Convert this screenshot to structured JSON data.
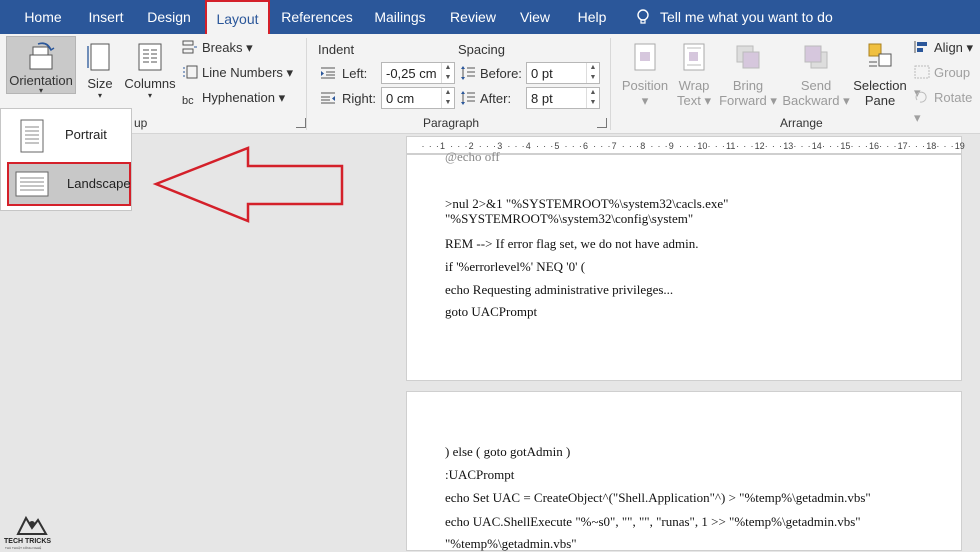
{
  "tabs": [
    "Home",
    "Insert",
    "Design",
    "Layout",
    "References",
    "Mailings",
    "Review",
    "View",
    "Help"
  ],
  "tell_me": "Tell me what you want to do",
  "page_setup": {
    "orientation": "Orientation",
    "size": "Size",
    "columns": "Columns",
    "breaks": "Breaks",
    "line_numbers": "Line Numbers",
    "hyphenation": "Hyphenation",
    "group_fragment": "up"
  },
  "paragraph": {
    "indent": "Indent",
    "spacing": "Spacing",
    "left_label": "Left:",
    "left_value": "-0,25 cm",
    "right_label": "Right:",
    "right_value": "0 cm",
    "before_label": "Before:",
    "before_value": "0 pt",
    "after_label": "After:",
    "after_value": "8 pt",
    "group": "Paragraph"
  },
  "arrange": {
    "position": [
      "Position",
      "▾"
    ],
    "wrap": [
      "Wrap",
      "Text ▾"
    ],
    "bring": [
      "Bring",
      "Forward ▾"
    ],
    "send": [
      "Send",
      "Backward ▾"
    ],
    "selection": [
      "Selection",
      "Pane"
    ],
    "align": "Align",
    "group": "Group",
    "rotate": "Rotate",
    "group_label": "Arrange"
  },
  "orientation_menu": {
    "portrait": "Portrait",
    "landscape": "Landscape"
  },
  "ruler_ticks": [
    "1",
    "2",
    "3",
    "4",
    "5",
    "6",
    "7",
    "8",
    "9",
    "10",
    "11",
    "12",
    "13",
    "14",
    "15",
    "16",
    "17",
    "18",
    "19"
  ],
  "page1_lines": [
    ">nul 2>&1 \"%SYSTEMROOT%\\system32\\cacls.exe\"",
    "\"%SYSTEMROOT%\\system32\\config\\system\"",
    "REM --> If error flag set, we do not have admin.",
    "if '%errorlevel%' NEQ '0' (",
    "echo Requesting administrative privileges...",
    "goto UACPrompt"
  ],
  "page2_lines": [
    ") else ( goto gotAdmin )",
    ":UACPrompt",
    "echo Set UAC = CreateObject^(\"Shell.Application\"^) > \"%temp%\\getadmin.vbs\"",
    "echo UAC.ShellExecute \"%~s0\", \"\", \"\", \"runas\", 1 >> \"%temp%\\getadmin.vbs\"",
    "\"%temp%\\getadmin.vbs\""
  ],
  "logo": {
    "title": "TECH TRICKS",
    "subtitle": "THỦ THUẬT CÔNG NGHỆ"
  },
  "colors": {
    "tabbar": "#2b579a",
    "highlight": "#d4202a",
    "ribbon": "#f3f3f3"
  }
}
